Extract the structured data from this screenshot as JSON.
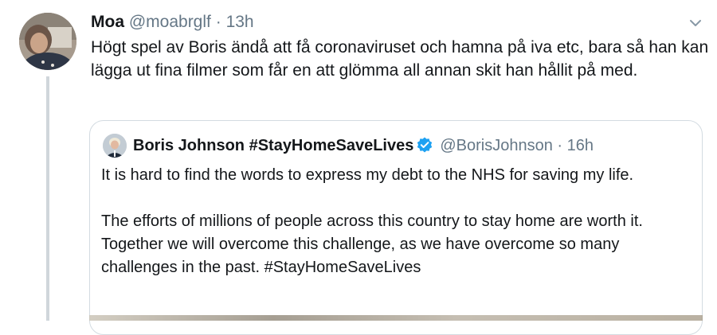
{
  "tweet": {
    "author_name": "Moa",
    "author_handle": "@moabrglf",
    "separator": "·",
    "time": "13h",
    "text": "Högt spel av Boris ändå att få coronaviruset och hamna på iva etc, bara så han kan lägga ut fina filmer som får en att glömma all annan skit han hållit på med.",
    "menu_icon": "chevron-down-icon"
  },
  "quoted_tweet": {
    "author_name": "Boris Johnson #StayHomeSaveLives",
    "verified_icon": "verified-badge-icon",
    "author_handle": "@BorisJohnson",
    "separator": "·",
    "time": "16h",
    "paragraph_1": "It is hard to find the words to express my debt to the NHS for saving my life.",
    "paragraph_2": "The efforts of millions of people across this country to stay home are worth it. Together we will overcome this challenge, as we have overcome so many challenges in the past. #StayHomeSaveLives"
  },
  "colors": {
    "text": "#14171a",
    "secondary_text": "#657786",
    "border": "#d3dbe1",
    "verified": "#1da1f2",
    "thread_line": "#d0d6db"
  }
}
